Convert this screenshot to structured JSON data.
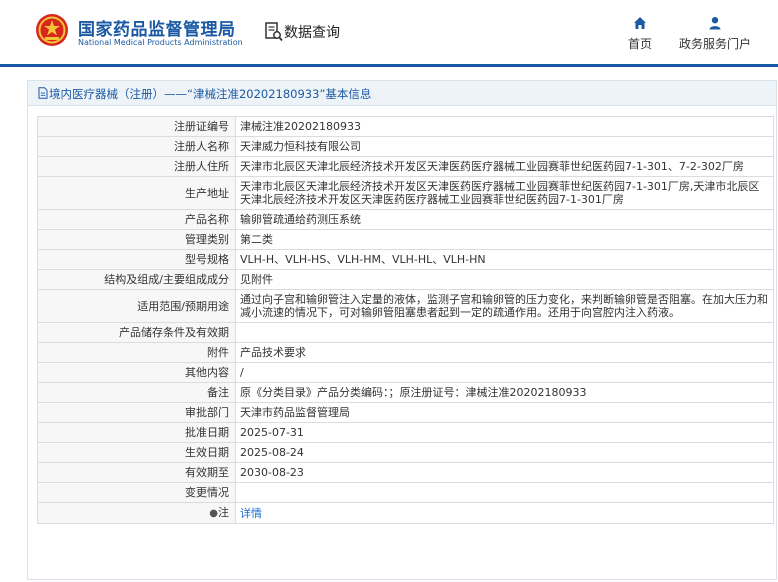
{
  "header": {
    "org_cn": "国家药品监督管理局",
    "org_en": "National Medical Products Administration",
    "query_label": "数据查询",
    "nav": [
      {
        "label": "首页",
        "icon": "home-icon"
      },
      {
        "label": "政务服务门户",
        "icon": "user-icon"
      }
    ],
    "brand_color": "#1b5aa3"
  },
  "panel": {
    "title": "境内医疗器械（注册）——“津械注准20202180933”基本信息",
    "title_icon": "document-icon"
  },
  "fields": {
    "reg_no": {
      "label": "注册证编号",
      "value": "津械注准20202180933"
    },
    "registrant": {
      "label": "注册人名称",
      "value": "天津威力恒科技有限公司"
    },
    "registrant_addr": {
      "label": "注册人住所",
      "value": "天津市北辰区天津北辰经济技术开发区天津医药医疗器械工业园赛菲世纪医药园7-1-301、7-2-302厂房"
    },
    "prod_addr": {
      "label": "生产地址",
      "value": "天津市北辰区天津北辰经济技术开发区天津医药医疗器械工业园赛菲世纪医药园7-1-301厂房,天津市北辰区天津北辰经济技术开发区天津医药医疗器械工业园赛菲世纪医药园7-1-301厂房"
    },
    "product_name": {
      "label": "产品名称",
      "value": "输卵管疏通给药测压系统"
    },
    "mgmt_class": {
      "label": "管理类别",
      "value": "第二类"
    },
    "model": {
      "label": "型号规格",
      "value": "VLH-H、VLH-HS、VLH-HM、VLH-HL、VLH-HN"
    },
    "structure": {
      "label": "结构及组成/主要组成成分",
      "value": "见附件"
    },
    "scope": {
      "label": "适用范围/预期用途",
      "value": "通过向子宫和输卵管注入定量的液体，监测子宫和输卵管的压力变化，来判断输卵管是否阻塞。在加大压力和减小流速的情况下，可对输卵管阻塞患者起到一定的疏通作用。还用于向宫腔内注入药液。"
    },
    "storage": {
      "label": "产品储存条件及有效期",
      "value": ""
    },
    "attachment": {
      "label": "附件",
      "value": "产品技术要求"
    },
    "other": {
      "label": "其他内容",
      "value": "/"
    },
    "remark": {
      "label": "备注",
      "value": "原《分类目录》产品分类编码：；原注册证号：津械注准20202180933"
    },
    "approver": {
      "label": "审批部门",
      "value": "天津市药品监督管理局"
    },
    "approve_date": {
      "label": "批准日期",
      "value": "2025-07-31"
    },
    "effective_date": {
      "label": "生效日期",
      "value": "2025-08-24"
    },
    "expiry": {
      "label": "有效期至",
      "value": "2030-08-23"
    },
    "changes": {
      "label": "变更情况",
      "value": ""
    },
    "note": {
      "label": "注",
      "pin": "●",
      "value": "详情"
    }
  }
}
